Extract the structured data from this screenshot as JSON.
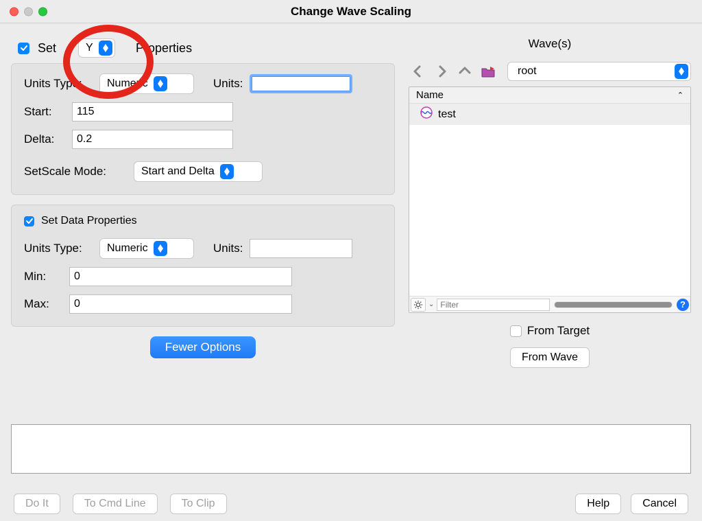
{
  "window": {
    "title": "Change Wave Scaling"
  },
  "setAxis": {
    "checkbox_label_prefix": "Set",
    "axis_select": "Y",
    "label_suffix": "Properties"
  },
  "axisPanel": {
    "units_type_label": "Units Type:",
    "units_type_value": "Numeric",
    "units_label": "Units:",
    "units_value": "",
    "start_label": "Start:",
    "start_value": "115",
    "delta_label": "Delta:",
    "delta_value": "0.2",
    "setscale_mode_label": "SetScale Mode:",
    "setscale_mode_value": "Start and Delta"
  },
  "dataPanel": {
    "checkbox_label": "Set Data Properties",
    "units_type_label": "Units Type:",
    "units_type_value": "Numeric",
    "units_label": "Units:",
    "units_value": "",
    "min_label": "Min:",
    "min_value": "0",
    "max_label": "Max:",
    "max_value": "0"
  },
  "buttons": {
    "fewer_options": "Fewer Options",
    "do_it": "Do It",
    "to_cmd_line": "To Cmd Line",
    "to_clip": "To Clip",
    "help": "Help",
    "cancel": "Cancel",
    "from_wave": "From Wave"
  },
  "wavesPanel": {
    "title": "Wave(s)",
    "root_select": "root",
    "name_header": "Name",
    "items": [
      {
        "label": "test"
      }
    ],
    "filter_placeholder": "Filter",
    "from_target_label": "From Target"
  }
}
